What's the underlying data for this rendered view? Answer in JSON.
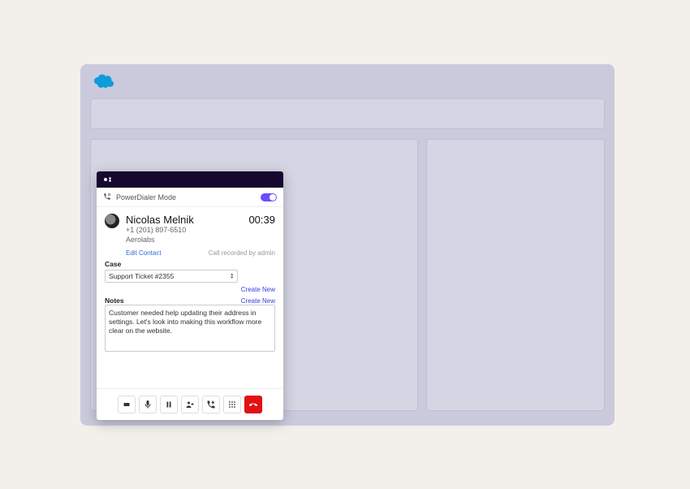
{
  "dialer": {
    "powerdialer_label": "PowerDialer Mode",
    "contact": {
      "name": "Nicolas Melnik",
      "phone": "+1 (201) 897-6510",
      "company": "Aerolabs"
    },
    "timer": "00:39",
    "edit_contact_label": "Edit Contact",
    "recorded_label": "Call recorded by admin",
    "case": {
      "label": "Case",
      "selected": "Support Ticket #2355",
      "create_new_label": "Create New"
    },
    "notes": {
      "label": "Notes",
      "value": "Customer needed help updating their address in settings. Let's look into making this workflow more clear on the website.",
      "create_new_label": "Create New"
    },
    "buttons": {
      "record": "record",
      "mute": "mute",
      "hold": "hold",
      "add": "add-participant",
      "transfer": "transfer",
      "dialpad": "dialpad",
      "end": "end-call"
    }
  }
}
